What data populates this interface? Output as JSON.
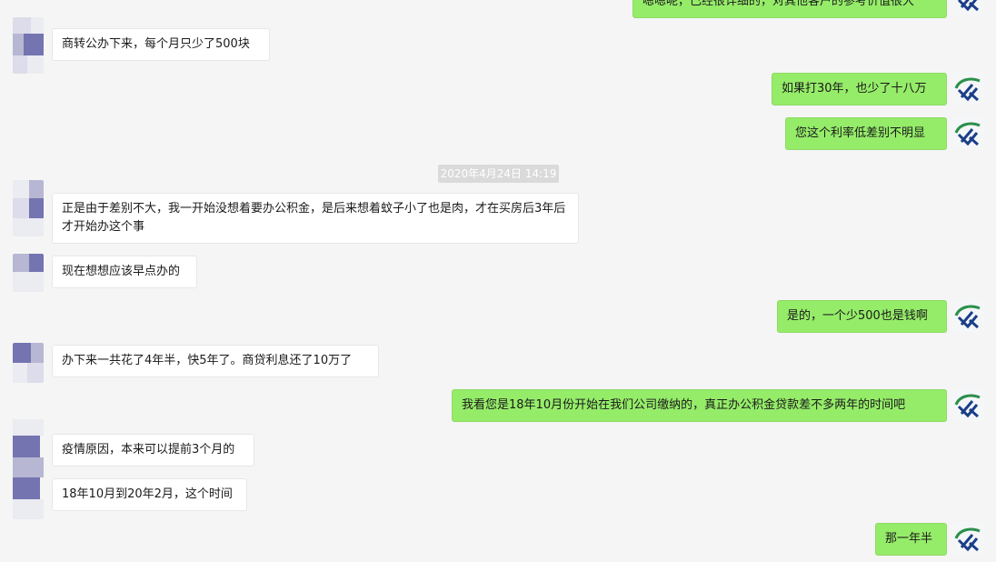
{
  "messages": {
    "top_right_partial": "嗯嗯呢，已经很详细的，对其他客户的参考价值很大",
    "m1": "商转公办下来，每个月只少了500块",
    "m2": "如果打30年，也少了十八万",
    "m3": "您这个利率低差别不明显",
    "timestamp": "2020年4月24日 14:19",
    "m4": "正是由于差别不大，我一开始没想着要办公积金，是后来想着蚊子小了也是肉，才在买房后3年后才开始办这个事",
    "m5": "现在想想应该早点办的",
    "m6": "是的，一个少500也是钱啊",
    "m7": "办下来一共花了4年半，快5年了。商贷利息还了10万了",
    "m8": "我看您是18年10月份开始在我们公司缴纳的，真正办公积金贷款差不多两年的时间吧",
    "m9": "疫情原因，本来可以提前3个月的",
    "m10": "18年10月到20年2月，这个时间",
    "m11": "那一年半"
  },
  "colors": {
    "background": "#f5f5f5",
    "sent_bubble": "#95ec69",
    "received_bubble": "#ffffff",
    "timestamp_bg": "#dadada"
  },
  "icons": {
    "left_avatar": "blurred-avatar",
    "right_avatar": "company-logo-avatar"
  }
}
